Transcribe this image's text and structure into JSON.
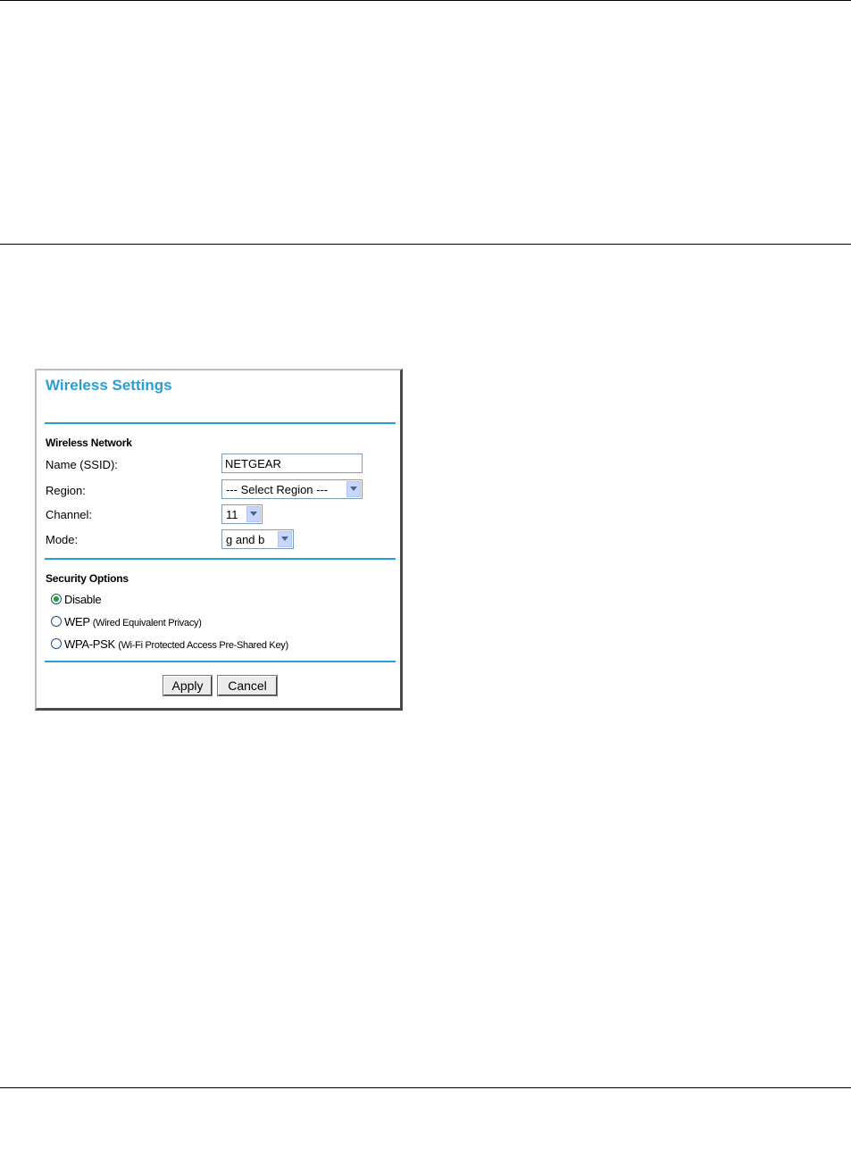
{
  "panel": {
    "title": "Wireless Settings",
    "wireless_network": {
      "section_label": "Wireless Network",
      "name_label": "Name (SSID):",
      "name_value": "NETGEAR",
      "region_label": "Region:",
      "region_value": "--- Select Region ---",
      "channel_label": "Channel:",
      "channel_value": "11",
      "mode_label": "Mode:",
      "mode_value": "g and b"
    },
    "security": {
      "section_label": "Security Options",
      "options": [
        {
          "label": "Disable",
          "sub": "",
          "checked": true
        },
        {
          "label": "WEP ",
          "sub": "(Wired Equivalent Privacy)",
          "checked": false
        },
        {
          "label": "WPA-PSK ",
          "sub": "(Wi-Fi Protected Access Pre-Shared Key)",
          "checked": false
        }
      ]
    },
    "buttons": {
      "apply": "Apply",
      "cancel": "Cancel"
    }
  },
  "colors": {
    "accent": "#2a9fd6",
    "radio_checked": "#21a121"
  },
  "icons": {
    "dropdown_arrow": "chevron-down-icon"
  }
}
